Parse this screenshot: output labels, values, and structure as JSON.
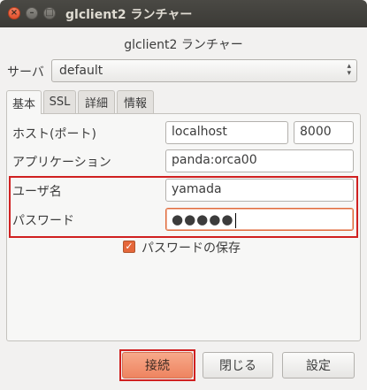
{
  "window": {
    "title": "glclient2 ランチャー",
    "close_glyph": "×",
    "min_glyph": "–",
    "max_glyph": "□"
  },
  "heading": "glclient2 ランチャー",
  "server": {
    "label": "サーバ",
    "value": "default",
    "arrows": "▴▾"
  },
  "tabs": [
    {
      "label": "基本",
      "active": true
    },
    {
      "label": "SSL",
      "active": false
    },
    {
      "label": "詳細",
      "active": false
    },
    {
      "label": "情報",
      "active": false
    }
  ],
  "form": {
    "host_label": "ホスト(ポート)",
    "host_value": "localhost",
    "port_value": "8000",
    "app_label": "アプリケーション",
    "app_value": "panda:orca00",
    "user_label": "ユーザ名",
    "user_value": "yamada",
    "password_label": "パスワード",
    "password_value": "●●●●●"
  },
  "save_password": {
    "label": "パスワードの保存",
    "checked": true,
    "glyph": "✓"
  },
  "buttons": {
    "connect": "接続",
    "close": "閉じる",
    "settings": "設定"
  }
}
